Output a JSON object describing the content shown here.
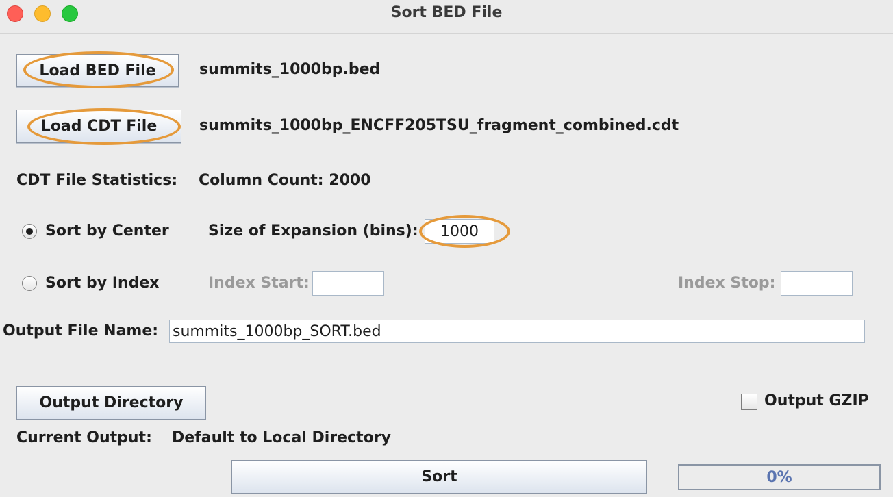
{
  "window": {
    "title": "Sort BED File"
  },
  "bed": {
    "button_label": "Load BED File",
    "filename": "summits_1000bp.bed"
  },
  "cdt": {
    "button_label": "Load CDT File",
    "filename": "summits_1000bp_ENCFF205TSU_fragment_combined.cdt"
  },
  "stats": {
    "label": "CDT File Statistics:",
    "value": "Column Count: 2000"
  },
  "sort_center": {
    "label": "Sort by Center",
    "selected": true,
    "expansion_label": "Size of Expansion (bins):",
    "expansion_value": "1000"
  },
  "sort_index": {
    "label": "Sort by Index",
    "selected": false,
    "start_label": "Index Start:",
    "start_value": "",
    "stop_label": "Index Stop:",
    "stop_value": ""
  },
  "output": {
    "name_label": "Output File Name:",
    "name_value": "summits_1000bp_SORT.bed",
    "dir_button_label": "Output Directory",
    "gzip_label": "Output GZIP",
    "gzip_checked": false,
    "current_label": "Current Output:",
    "current_value": "Default to Local Directory"
  },
  "action": {
    "sort_label": "Sort"
  },
  "progress": {
    "value": 0,
    "text": "0%"
  },
  "colors": {
    "highlight": "#e59a3b",
    "progress_text": "#5a74b0"
  }
}
